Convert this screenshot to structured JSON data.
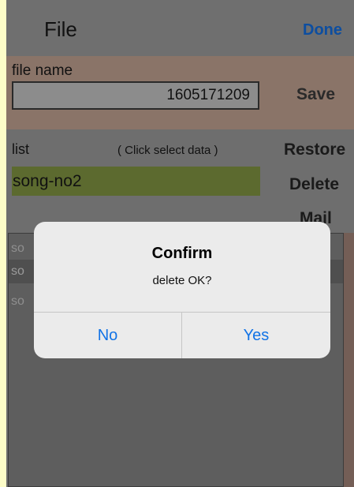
{
  "header": {
    "title": "File",
    "done_label": "Done"
  },
  "file": {
    "label": "file name",
    "value": "1605171209",
    "save_label": "Save"
  },
  "list": {
    "label": "list",
    "hint": "( Click select data )",
    "restore_label": "Restore",
    "selected_value": "song-no2",
    "delete_label": "Delete",
    "mail_label": "Mail",
    "rows": [
      "so",
      "so",
      "so"
    ]
  },
  "dialog": {
    "title": "Confirm",
    "message": "delete OK?",
    "no_label": "No",
    "yes_label": "Yes"
  },
  "colors": {
    "accent_blue": "#1273e6",
    "done_blue": "#0d4ea0",
    "selected_green": "#5c6a2f",
    "file_section": "#8a7468"
  }
}
